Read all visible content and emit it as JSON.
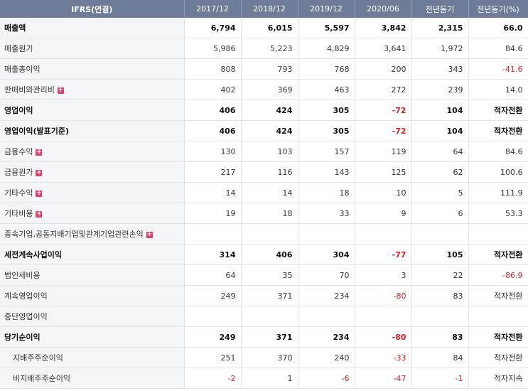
{
  "table": {
    "headers": [
      "IFRS(연결)",
      "2017/12",
      "2018/12",
      "2019/12",
      "2020/06",
      "전년동기",
      "전년동기(%)"
    ],
    "rows": [
      {
        "label": "매출액",
        "bold": true,
        "expand": false,
        "indent": false,
        "values": [
          "6,794",
          "6,015",
          "5,597",
          "3,842",
          "2,315",
          "66.0"
        ]
      },
      {
        "label": "매출원가",
        "bold": false,
        "expand": false,
        "indent": false,
        "values": [
          "5,986",
          "5,223",
          "4,829",
          "3,641",
          "1,972",
          "84.6"
        ]
      },
      {
        "label": "매출총이익",
        "bold": false,
        "expand": false,
        "indent": false,
        "values": [
          "808",
          "793",
          "768",
          "200",
          "343",
          "-41.6"
        ]
      },
      {
        "label": "판매비와관리비",
        "bold": false,
        "expand": true,
        "indent": false,
        "values": [
          "402",
          "369",
          "463",
          "272",
          "239",
          "14.0"
        ]
      },
      {
        "label": "영업이익",
        "bold": true,
        "expand": false,
        "indent": false,
        "values": [
          "406",
          "424",
          "305",
          "-72",
          "104",
          "적자전환"
        ]
      },
      {
        "label": "영업이익(발표기준)",
        "bold": true,
        "expand": false,
        "indent": false,
        "values": [
          "406",
          "424",
          "305",
          "-72",
          "104",
          "적자전환"
        ]
      },
      {
        "label": "금융수익",
        "bold": false,
        "expand": true,
        "indent": false,
        "values": [
          "130",
          "103",
          "157",
          "119",
          "64",
          "84.6"
        ]
      },
      {
        "label": "금융원가",
        "bold": false,
        "expand": true,
        "indent": false,
        "values": [
          "217",
          "116",
          "143",
          "125",
          "62",
          "100.6"
        ]
      },
      {
        "label": "기타수익",
        "bold": false,
        "expand": true,
        "indent": false,
        "values": [
          "14",
          "14",
          "18",
          "10",
          "5",
          "111.9"
        ]
      },
      {
        "label": "기타비용",
        "bold": false,
        "expand": true,
        "indent": false,
        "values": [
          "19",
          "18",
          "33",
          "9",
          "6",
          "53.3"
        ]
      },
      {
        "label": "종속기업,공동지배기업및관계기업관련손익",
        "bold": false,
        "expand": true,
        "indent": false,
        "values": [
          "",
          "",
          "",
          "",
          "",
          ""
        ]
      },
      {
        "label": "세전계속사업이익",
        "bold": true,
        "expand": false,
        "indent": false,
        "values": [
          "314",
          "406",
          "304",
          "-77",
          "105",
          "적자전환"
        ]
      },
      {
        "label": "법인세비용",
        "bold": false,
        "expand": false,
        "indent": false,
        "values": [
          "64",
          "35",
          "70",
          "3",
          "22",
          "-86.9"
        ]
      },
      {
        "label": "계속영업이익",
        "bold": false,
        "expand": false,
        "indent": false,
        "values": [
          "249",
          "371",
          "234",
          "-80",
          "83",
          "적자전환"
        ]
      },
      {
        "label": "중단영업이익",
        "bold": false,
        "expand": false,
        "indent": false,
        "values": [
          "",
          "",
          "",
          "",
          "",
          ""
        ]
      },
      {
        "label": "당기순이익",
        "bold": true,
        "expand": false,
        "indent": false,
        "values": [
          "249",
          "371",
          "234",
          "-80",
          "83",
          "적자전환"
        ]
      },
      {
        "label": "지배주주순이익",
        "bold": false,
        "expand": false,
        "indent": true,
        "values": [
          "251",
          "370",
          "240",
          "-33",
          "84",
          "적자전환"
        ]
      },
      {
        "label": "비지배주주순이익",
        "bold": false,
        "expand": false,
        "indent": true,
        "values": [
          "-2",
          "1",
          "-6",
          "-47",
          "-1",
          "적자지속"
        ]
      }
    ],
    "expand_icon": "plus-icon",
    "negative_color": "#e02020",
    "header_color": "#6f7c97"
  }
}
